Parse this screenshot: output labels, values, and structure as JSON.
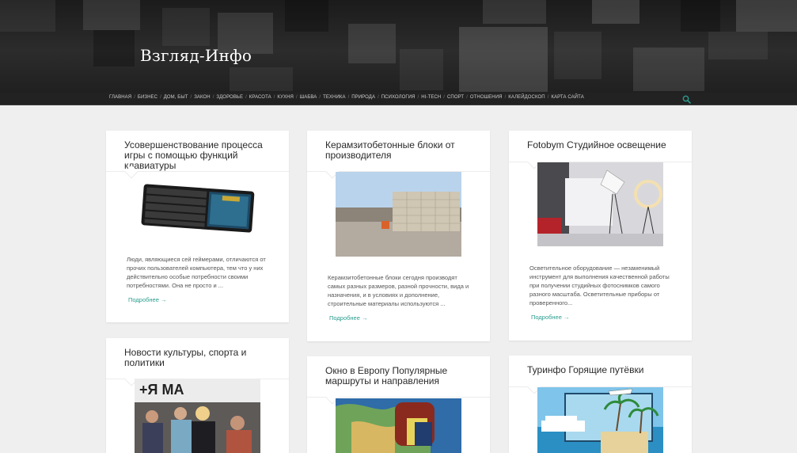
{
  "site": {
    "title": "Взгляд-Инфо"
  },
  "nav": {
    "items": [
      "Главная",
      "Бизнес",
      "Дом, быт",
      "Закон",
      "Здоровье",
      "Красота",
      "Кухня",
      "Шабва",
      "Техника",
      "Природа",
      "Психология",
      "Hi-tech",
      "Спорт",
      "Отношения",
      "Калейдоскоп",
      "Карта сайта"
    ],
    "search_icon": "search-icon"
  },
  "colors": {
    "accent": "#2a9d8f",
    "header_bg": "#222222",
    "page_bg": "#efefef"
  },
  "cards": [
    {
      "title": "Усовершенствование процесса игры с помощью функций клавиатуры",
      "text": "Люди, являющиеся сей геймерами, отличаются от прочих пользователей компьютера, тем что у них действительно особые потребности своими потребностями. Она не просто и ...",
      "more": "Подробнее →"
    },
    {
      "title": "Керамзитобетонные блоки от производителя",
      "text": "Керамзитобетонные блоки сегодня производят самых разных размеров, разной прочности, вида и назначения, и в условиях и дополнение, строительные материалы используются ...",
      "more": "Подробнее →"
    },
    {
      "title": "Fotobym Студийное освещение",
      "text": "Осветительное оборудование — незаменимый инструмент для выполнения качественной работы при получении студийных фотоснимков самого разного масштаба. Осветительные приборы от проверенного...",
      "more": "Подробнее →"
    },
    {
      "title": "Новости культуры, спорта и политики",
      "image_caption": "+Я МА"
    },
    {
      "title": "Окно в Европу Популярные маршруты и направления"
    },
    {
      "title": "Туринфо Горящие путёвки"
    }
  ]
}
